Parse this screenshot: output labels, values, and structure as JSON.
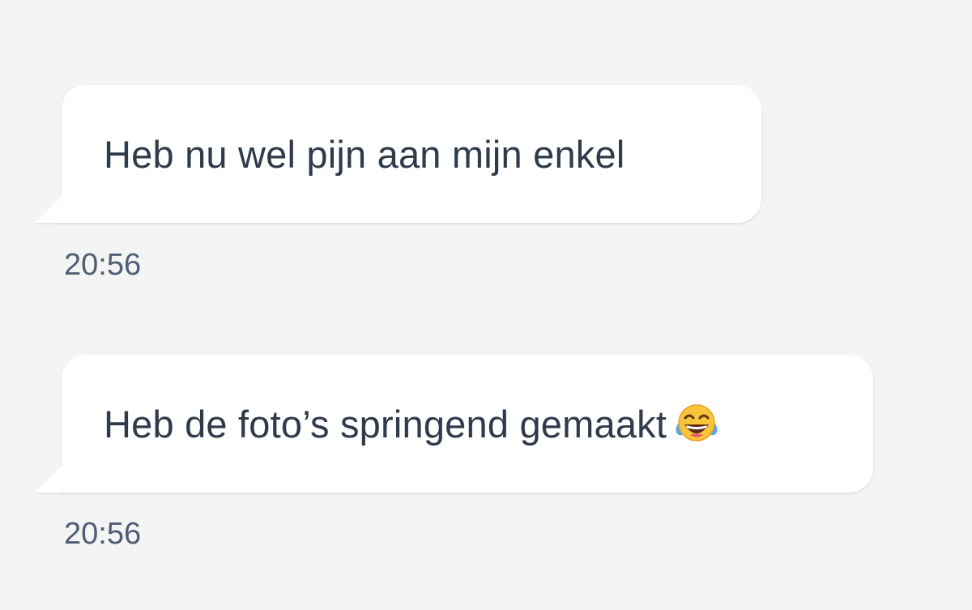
{
  "messages": [
    {
      "text": "Heb nu wel pijn aan mijn enkel",
      "time": "20:56",
      "emoji": ""
    },
    {
      "text": "Heb de foto’s springend gemaakt",
      "time": "20:56",
      "emoji": "face-with-tears-of-joy-icon"
    }
  ],
  "colors": {
    "background": "#f4f4f5",
    "bubble": "#ffffff",
    "text": "#2f3a4a",
    "timestamp": "#4f5e74"
  }
}
